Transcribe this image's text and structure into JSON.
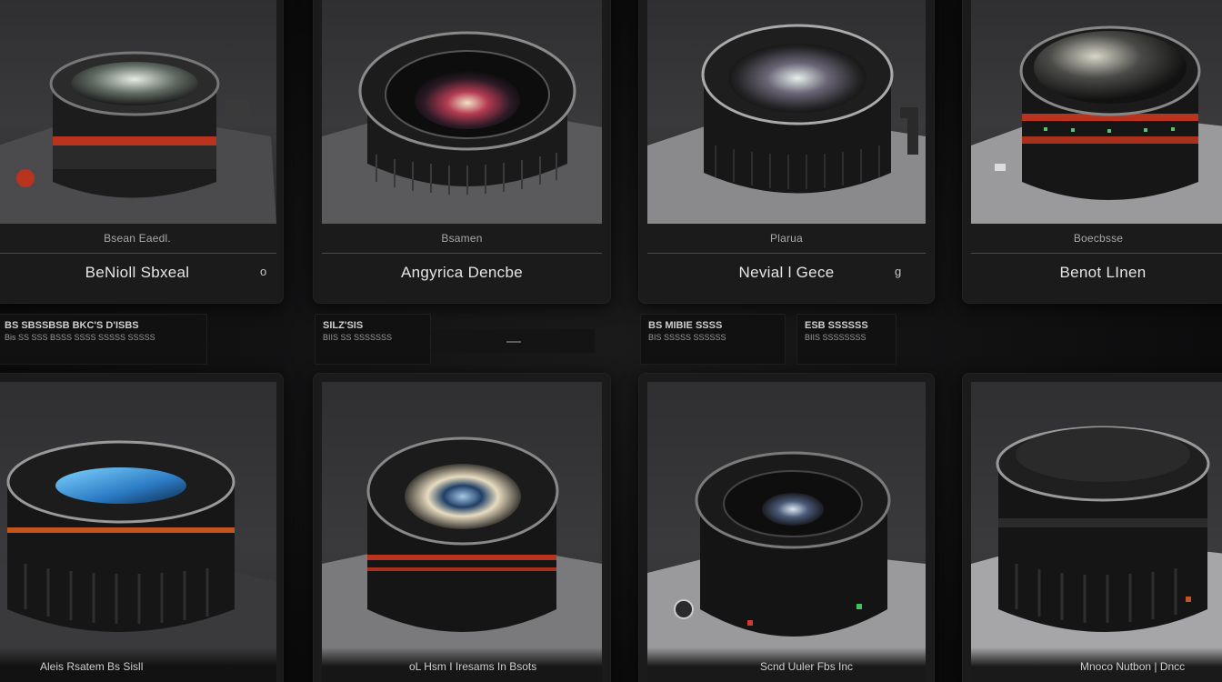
{
  "top_cards": [
    {
      "category": "Bsean   Eaedl.",
      "name": "BeNioll Sbxeal",
      "mark": "o"
    },
    {
      "category": "Bsamen",
      "name": "Angyrica Dencbe",
      "mark": ""
    },
    {
      "category": "Plarua",
      "name": "Nevial l Gece",
      "mark": "g"
    },
    {
      "category": "Boecbsse",
      "name": "Benot LInen",
      "mark": ""
    }
  ],
  "info_strips": [
    {
      "line1": "BS SBSSBSB BKC'S D'ISBS",
      "line2": "Bis SS SSS BSSS SSSS SSSSS SSSSS"
    },
    {
      "line1": "SILZ'SIS",
      "line2": "BIIS SS SSSSSSS"
    },
    {
      "line1": "BS MIBIE SSSS",
      "line2": "BIS SSSSS SSSSSS"
    },
    {
      "line1": "ESB SSSSSS",
      "line2": "BIIS SSSSSSSS"
    }
  ],
  "bottom_cards": [
    {
      "caption": "Aleis  Rsatem  Bs Sisll"
    },
    {
      "caption": "oL  Hsm I Iresams   In Bsots"
    },
    {
      "caption": "Scnd  Uuler  Fbs Inc"
    },
    {
      "caption": "Mnoco  Nutbon  |     Dncc"
    }
  ],
  "colors": {
    "background": "#0d0d0e",
    "card": "#1b1b1c",
    "accent_red": "#b8341f",
    "accent_orange": "#c2551e"
  }
}
